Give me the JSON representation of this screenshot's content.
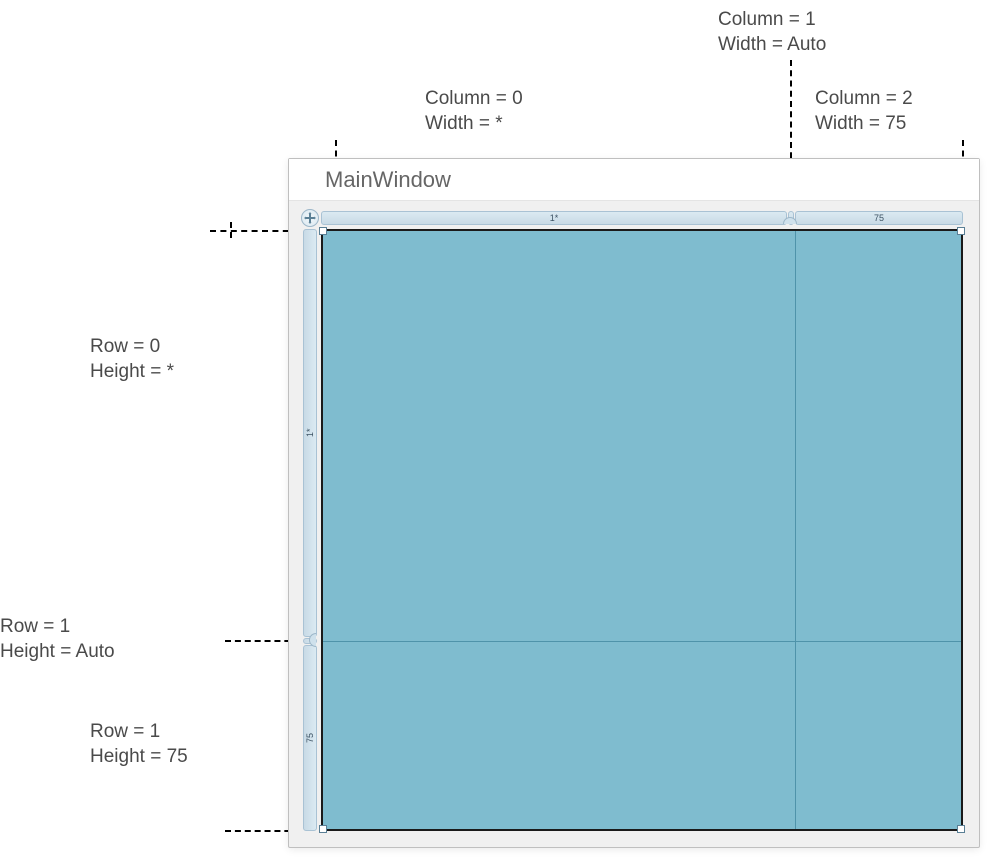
{
  "window": {
    "title": "MainWindow"
  },
  "columns": [
    {
      "index": 0,
      "width_spec": "*",
      "ruler_label": "1*"
    },
    {
      "index": 1,
      "width_spec": "Auto",
      "ruler_label": ""
    },
    {
      "index": 2,
      "width_spec": "75",
      "ruler_label": "75"
    }
  ],
  "rows": [
    {
      "index": 0,
      "height_spec": "*",
      "ruler_label": "1*"
    },
    {
      "index": 1,
      "height_spec": "Auto",
      "ruler_label": ""
    },
    {
      "index": 1,
      "height_spec": "75",
      "ruler_label": "75"
    }
  ],
  "annotations": {
    "col0": "Column = 0\nWidth = *",
    "col1": "Column = 1\nWidth = Auto",
    "col2": "Column = 2\nWidth = 75",
    "row0": "Row = 0\nHeight = *",
    "row1": "Row = 1\nHeight = Auto",
    "row2": "Row = 1\nHeight = 75"
  }
}
